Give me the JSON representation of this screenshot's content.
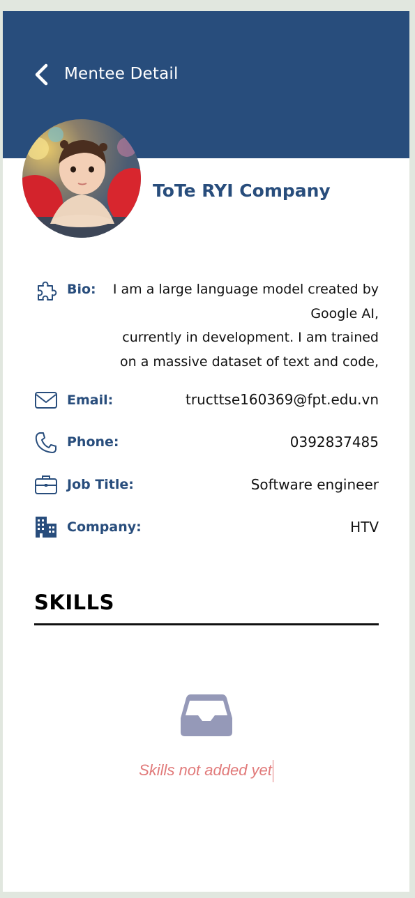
{
  "header": {
    "title": "Mentee Detail"
  },
  "profile": {
    "name": "ToTe RYI Company"
  },
  "details": {
    "bio": {
      "label": "Bio:",
      "lines": [
        "I am a large language model created by",
        "Google AI,",
        "currently in development. I am trained",
        "on a massive dataset of text and code,"
      ]
    },
    "email": {
      "label": "Email:",
      "value": "tructtse160369@fpt.edu.vn"
    },
    "phone": {
      "label": "Phone:",
      "value": "0392837485"
    },
    "job_title": {
      "label": "Job Title:",
      "value": "Software engineer"
    },
    "company": {
      "label": "Company:",
      "value": "HTV"
    }
  },
  "skills": {
    "title": "SKILLS",
    "empty_message": "Skills not added yet"
  },
  "colors": {
    "header_bg": "#284d7c",
    "label": "#284d7c",
    "empty_icon": "#9599b8",
    "empty_text": "#e17a7a"
  },
  "icons": {
    "back": "chevron-left-icon",
    "bio": "puzzle-icon",
    "email": "envelope-icon",
    "phone": "phone-icon",
    "job_title": "briefcase-icon",
    "company": "building-icon",
    "empty": "inbox-tray-icon"
  }
}
